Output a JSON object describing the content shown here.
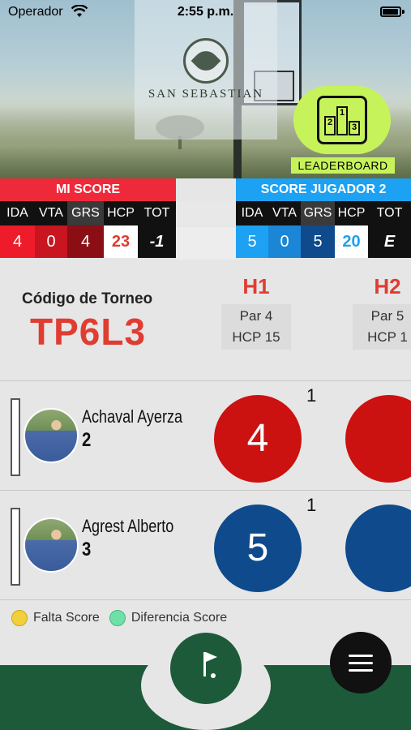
{
  "status_bar": {
    "carrier": "Operador",
    "time": "2:55 p.m."
  },
  "header": {
    "club_name": "SAN SEBASTIAN",
    "leaderboard_label": "LEADERBOARD",
    "podium": [
      "2",
      "1",
      "3"
    ]
  },
  "my_score": {
    "title": "MI SCORE",
    "columns": [
      "IDA",
      "VTA",
      "GRS",
      "HCP",
      "TOT"
    ],
    "values": [
      "4",
      "0",
      "4",
      "23",
      "-1"
    ]
  },
  "player2_score": {
    "title": "SCORE JUGADOR 2",
    "columns": [
      "IDA",
      "VTA",
      "GRS",
      "HCP",
      "TOT"
    ],
    "values": [
      "5",
      "0",
      "5",
      "20",
      "E"
    ]
  },
  "tournament": {
    "label": "Código de Torneo",
    "code": "TP6L3"
  },
  "holes": [
    {
      "name": "H1",
      "par": "Par 4",
      "hcp": "HCP 15"
    },
    {
      "name": "H2",
      "par": "Par 5",
      "hcp": "HCP 1"
    }
  ],
  "players": [
    {
      "name": "Achaval Ayerza",
      "hcp": "2",
      "hole1_score": "4",
      "hole1_mark": "1",
      "color": "#cc1111"
    },
    {
      "name": "Agrest Alberto",
      "hcp": "3",
      "hole1_score": "5",
      "hole1_mark": "1",
      "color": "#0e4a8c"
    }
  ],
  "legend": [
    {
      "label": "Falta Score",
      "color": "#f2d03b"
    },
    {
      "label": "Diferencia Score",
      "color": "#6fe0a8"
    }
  ],
  "colors": {
    "accent_red": "#e03c31",
    "blue": "#1da1f2",
    "green": "#1d5a3a",
    "leaderboard": "#c7f35a"
  }
}
